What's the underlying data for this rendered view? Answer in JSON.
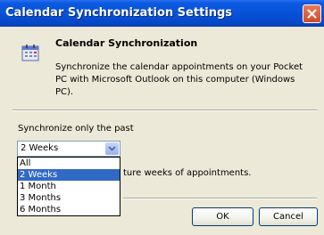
{
  "window": {
    "title": "Calendar Synchronization Settings",
    "close_icon": "close-icon",
    "title_color": "#0852d8"
  },
  "header": {
    "icon": "calendar-icon",
    "heading": "Calendar Synchronization",
    "description": "Synchronize the calendar appointments on your Pocket PC with Microsoft Outlook on this computer (Windows PC)."
  },
  "sync": {
    "label": "Synchronize only the past",
    "selected_value": "2 Weeks",
    "options": [
      "All",
      "2 Weeks",
      "1 Month",
      "3 Months",
      "6 Months"
    ],
    "highlighted_option": "2 Weeks",
    "trailing_text": "ture weeks of appointments.",
    "highlight_color": "#316ac5"
  },
  "buttons": {
    "ok": "OK",
    "cancel": "Cancel"
  }
}
